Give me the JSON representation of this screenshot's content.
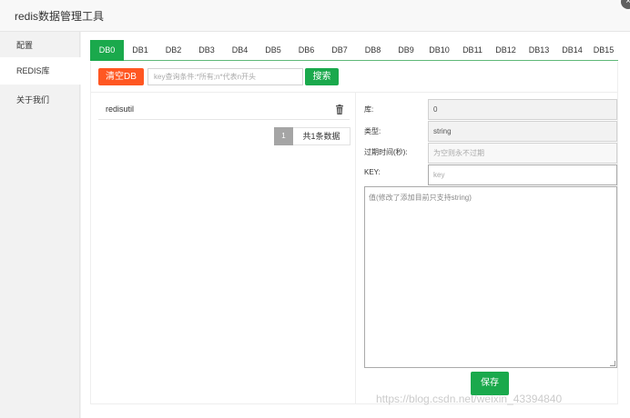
{
  "window": {
    "title": "redis数据管理工具",
    "close_symbol": "×"
  },
  "sidebar": {
    "items": [
      {
        "label": "配置",
        "active": false
      },
      {
        "label": "REDIS库",
        "active": true
      },
      {
        "label": "关于我们",
        "active": false
      }
    ]
  },
  "tabs": [
    {
      "label": "DB0",
      "active": true
    },
    {
      "label": "DB1"
    },
    {
      "label": "DB2"
    },
    {
      "label": "DB3"
    },
    {
      "label": "DB4"
    },
    {
      "label": "DB5"
    },
    {
      "label": "DB6"
    },
    {
      "label": "DB7"
    },
    {
      "label": "DB8"
    },
    {
      "label": "DB9"
    },
    {
      "label": "DB10"
    },
    {
      "label": "DB11"
    },
    {
      "label": "DB12"
    },
    {
      "label": "DB13"
    },
    {
      "label": "DB14"
    },
    {
      "label": "DB15"
    }
  ],
  "toolbar": {
    "clear_label": "清空DB",
    "search_placeholder": "key查询条件:*所有;n*代表n开头",
    "search_label": "搜索"
  },
  "key_list": {
    "items": [
      {
        "name": "redisutil",
        "icon": "trash-icon"
      }
    ],
    "pager": {
      "current_page": "1",
      "total_text": "共1条数据"
    }
  },
  "detail": {
    "db_label": "库:",
    "db_value": "0",
    "type_label": "类型:",
    "type_value": "string",
    "ttl_label": "过期时间(秒):",
    "ttl_placeholder": "为空则永不过期",
    "key_label": "KEY:",
    "key_placeholder": "key",
    "value_placeholder": "值(修改了添加目前只支持string)",
    "save_label": "保存"
  },
  "watermark": "https://blog.csdn.net/weixin_43394840",
  "colors": {
    "primary_green": "#1aa94c",
    "danger_orange": "#ff5722",
    "pager_gray": "#a5a5a5"
  }
}
